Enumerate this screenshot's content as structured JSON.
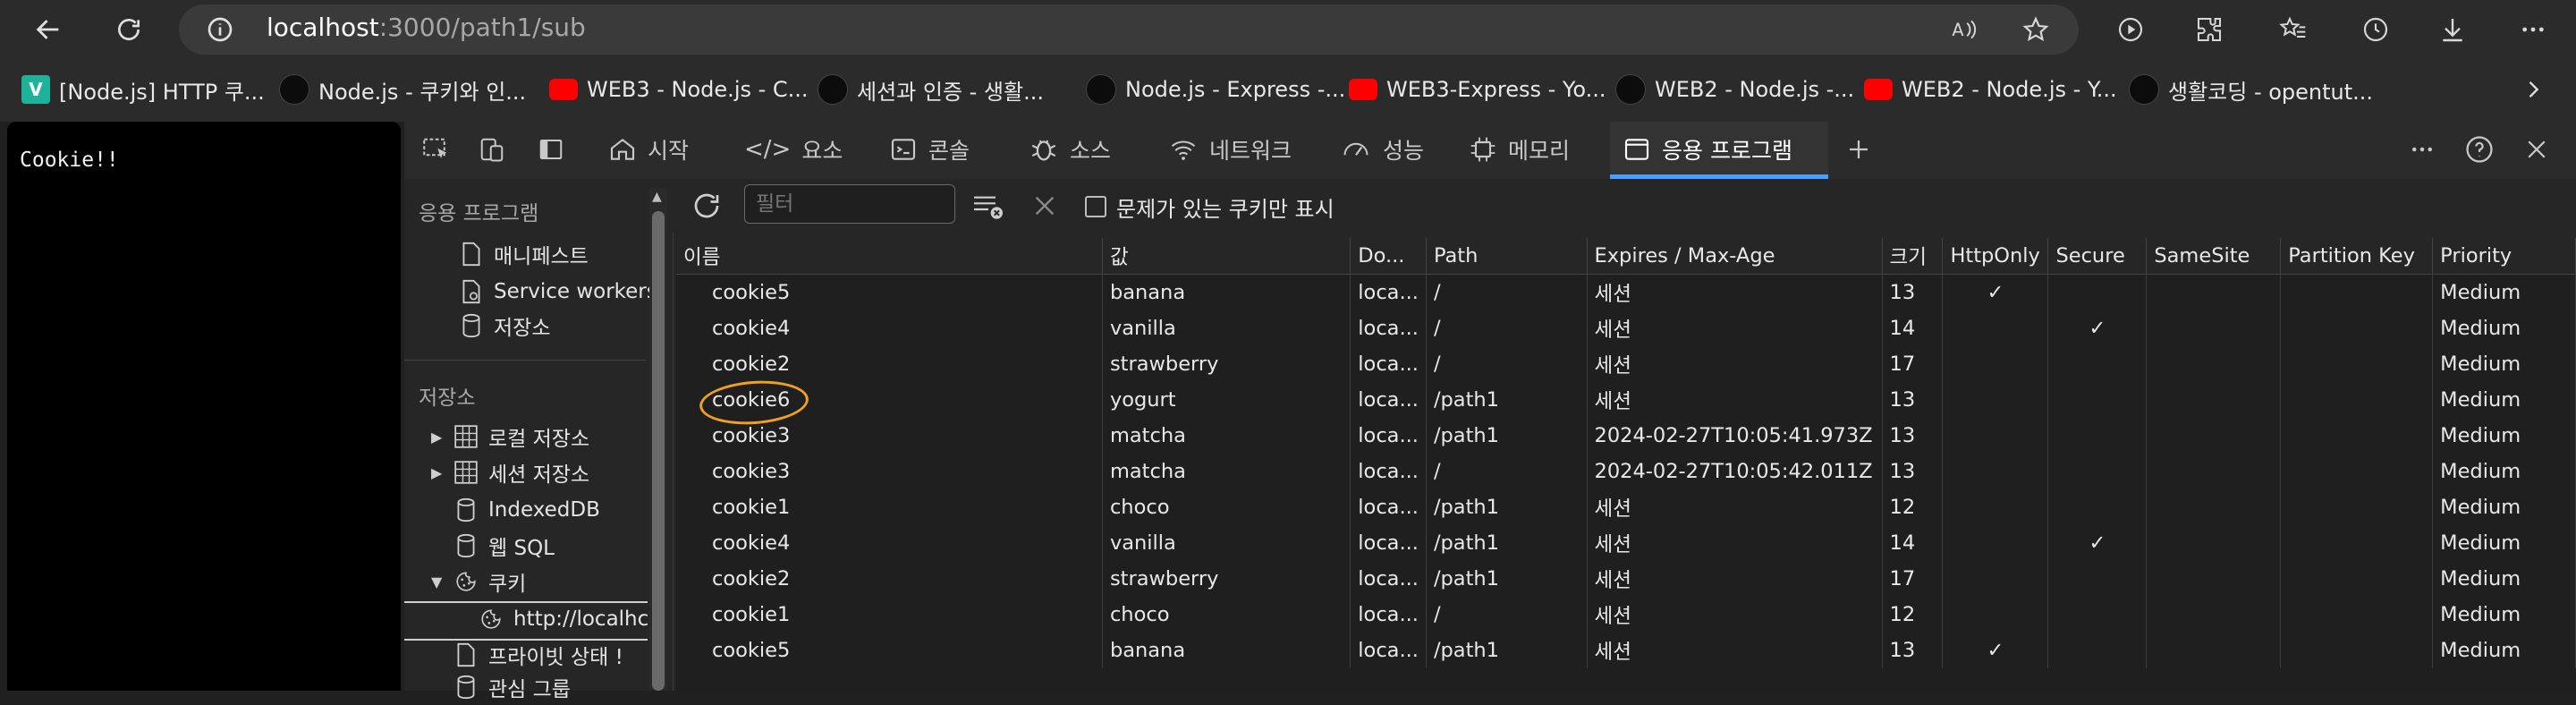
{
  "browser": {
    "url_host": "localhost",
    "url_rest": ":3000/path1/sub"
  },
  "bookmarks": [
    {
      "label": "[Node.js] HTTP 쿠...",
      "icon": "v-icon"
    },
    {
      "label": "Node.js - 쿠키와 인...",
      "icon": "github-icon"
    },
    {
      "label": "WEB3 - Node.js - C...",
      "icon": "youtube-icon"
    },
    {
      "label": "세션과 인증 - 생활...",
      "icon": "github-icon"
    },
    {
      "label": "Node.js - Express -...",
      "icon": "github-icon"
    },
    {
      "label": "WEB3-Express - Yo...",
      "icon": "youtube-icon"
    },
    {
      "label": "WEB2 - Node.js -...",
      "icon": "github-icon"
    },
    {
      "label": "WEB2 - Node.js - Y...",
      "icon": "youtube-icon"
    },
    {
      "label": "생활코딩 - opentut...",
      "icon": "github-icon"
    }
  ],
  "page": {
    "text": "Cookie!!"
  },
  "devtools": {
    "tabs": [
      {
        "label": "시작"
      },
      {
        "label": "요소"
      },
      {
        "label": "콘솔"
      },
      {
        "label": "소스"
      },
      {
        "label": "네트워크"
      },
      {
        "label": "성능"
      },
      {
        "label": "메모리"
      },
      {
        "label": "응용 프로그램"
      }
    ],
    "sidebar": {
      "app_header": "응용 프로그램",
      "manifest": "매니페스트",
      "service_workers": "Service workers",
      "storage_item": "저장소",
      "storage_header": "저장소",
      "local_storage": "로컬 저장소",
      "session_storage": "세션 저장소",
      "indexeddb": "IndexedDB",
      "websql": "웹 SQL",
      "cookies": "쿠키",
      "cookie_origin": "http://localhc",
      "private_state": "프라이빗 상태 !",
      "interest_group": "관심 그룹"
    },
    "filter": {
      "placeholder": "필터",
      "checkbox_label": "문제가 있는 쿠키만 표시"
    },
    "columns": [
      "이름",
      "값",
      "Do...",
      "Path",
      "Expires / Max-Age",
      "크기",
      "HttpOnly",
      "Secure",
      "SameSite",
      "Partition Key",
      "Priority"
    ],
    "rows": [
      {
        "name": "cookie5",
        "value": "banana",
        "domain": "loca...",
        "path": "/",
        "expires": "세션",
        "size": "13",
        "httponly": "✓",
        "secure": "",
        "samesite": "",
        "partition": "",
        "priority": "Medium"
      },
      {
        "name": "cookie4",
        "value": "vanilla",
        "domain": "loca...",
        "path": "/",
        "expires": "세션",
        "size": "14",
        "httponly": "",
        "secure": "✓",
        "samesite": "",
        "partition": "",
        "priority": "Medium"
      },
      {
        "name": "cookie2",
        "value": "strawberry",
        "domain": "loca...",
        "path": "/",
        "expires": "세션",
        "size": "17",
        "httponly": "",
        "secure": "",
        "samesite": "",
        "partition": "",
        "priority": "Medium"
      },
      {
        "name": "cookie6",
        "value": "yogurt",
        "domain": "loca...",
        "path": "/path1",
        "expires": "세션",
        "size": "13",
        "httponly": "",
        "secure": "",
        "samesite": "",
        "partition": "",
        "priority": "Medium"
      },
      {
        "name": "cookie3",
        "value": "matcha",
        "domain": "loca...",
        "path": "/path1",
        "expires": "2024-02-27T10:05:41.973Z",
        "size": "13",
        "httponly": "",
        "secure": "",
        "samesite": "",
        "partition": "",
        "priority": "Medium"
      },
      {
        "name": "cookie3",
        "value": "matcha",
        "domain": "loca...",
        "path": "/",
        "expires": "2024-02-27T10:05:42.011Z",
        "size": "13",
        "httponly": "",
        "secure": "",
        "samesite": "",
        "partition": "",
        "priority": "Medium"
      },
      {
        "name": "cookie1",
        "value": "choco",
        "domain": "loca...",
        "path": "/path1",
        "expires": "세션",
        "size": "12",
        "httponly": "",
        "secure": "",
        "samesite": "",
        "partition": "",
        "priority": "Medium"
      },
      {
        "name": "cookie4",
        "value": "vanilla",
        "domain": "loca...",
        "path": "/path1",
        "expires": "세션",
        "size": "14",
        "httponly": "",
        "secure": "✓",
        "samesite": "",
        "partition": "",
        "priority": "Medium"
      },
      {
        "name": "cookie2",
        "value": "strawberry",
        "domain": "loca...",
        "path": "/path1",
        "expires": "세션",
        "size": "17",
        "httponly": "",
        "secure": "",
        "samesite": "",
        "partition": "",
        "priority": "Medium"
      },
      {
        "name": "cookie1",
        "value": "choco",
        "domain": "loca...",
        "path": "/",
        "expires": "세션",
        "size": "12",
        "httponly": "",
        "secure": "",
        "samesite": "",
        "partition": "",
        "priority": "Medium"
      },
      {
        "name": "cookie5",
        "value": "banana",
        "domain": "loca...",
        "path": "/path1",
        "expires": "세션",
        "size": "13",
        "httponly": "✓",
        "secure": "",
        "samesite": "",
        "partition": "",
        "priority": "Medium"
      }
    ]
  },
  "colors": {
    "accent": "#4a9eff",
    "highlight_circle": "#f0a020"
  }
}
